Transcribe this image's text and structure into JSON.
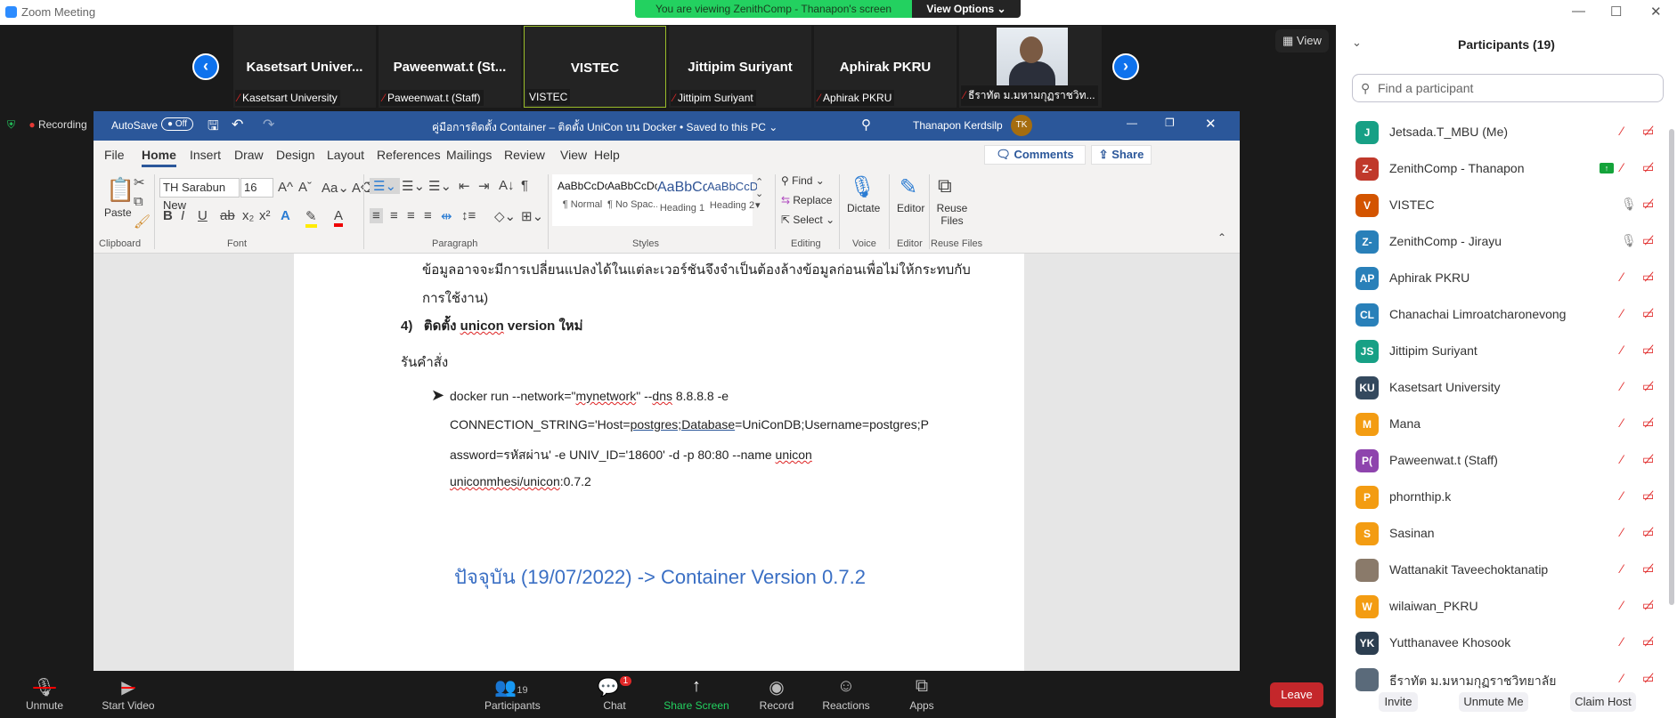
{
  "app_title": "Zoom Meeting",
  "banner": "You are viewing ZenithComp - Thanapon's screen",
  "view_options": "View Options ⌄",
  "view_button": "View",
  "recording": "Recording",
  "thumbnails": [
    {
      "big": "Kasetsart  Univer...",
      "small": "Kasetsart University",
      "muted": true
    },
    {
      "big": "Paweenwat.t  (St...",
      "small": "Paweenwat.t (Staff)",
      "muted": true
    },
    {
      "big": "VISTEC",
      "small": "VISTEC",
      "muted": false,
      "active": true
    },
    {
      "big": "Jittipim Suriyant",
      "small": "Jittipim Suriyant",
      "muted": true
    },
    {
      "big": "Aphirak PKRU",
      "small": "Aphirak PKRU",
      "muted": true
    },
    {
      "big": "",
      "small": "ธีราทัต ม.มหามกุฏราชวิท...",
      "muted": true,
      "photo": true
    }
  ],
  "word": {
    "autosave": "AutoSave",
    "autosave_state": "Off",
    "doc_title": "คู่มือการติดตั้ง Container – ติดตั้ง UniCon บน Docker • Saved to this PC ⌄",
    "user": "Thanapon Kerdsilp",
    "user_initials": "TK",
    "tabs": [
      "File",
      "Home",
      "Insert",
      "Draw",
      "Design",
      "Layout",
      "References",
      "Mailings",
      "Review",
      "View",
      "Help"
    ],
    "comments": "Comments",
    "share": "Share",
    "font": "TH Sarabun New",
    "size": "16",
    "paste": "Paste",
    "groups": [
      "Clipboard",
      "Font",
      "Paragraph",
      "Styles",
      "Editing",
      "Voice",
      "Editor",
      "Reuse Files"
    ],
    "styles": [
      {
        "preview": "AaBbCcDc",
        "name": "¶ Normal"
      },
      {
        "preview": "AaBbCcDc",
        "name": "¶ No Spac..."
      },
      {
        "preview": "AaBbCc",
        "name": "Heading 1"
      },
      {
        "preview": "AaBbCcD",
        "name": "Heading 2"
      }
    ],
    "find": "Find ⌄",
    "replace": "Replace",
    "select": "Select ⌄",
    "dictate": "Dictate",
    "editor": "Editor",
    "reuse_files": "Reuse Files",
    "doc": {
      "line1": "ข้อมูลอาจจะมีการเปลี่ยนแปลงได้ในแต่ละเวอร์ชันจึงจำเป็นต้องล้างข้อมูลก่อนเพื่อไม่ให้กระทบกับ",
      "line2": "การใช้งาน)",
      "step_num": "4)",
      "step_a": "ติดตั้ง ",
      "step_b": "unicon",
      "step_c": " version ใหม่",
      "run": "รันคำสั่ง",
      "cmd1a": "docker run --network=\"",
      "cmd1b": "mynetwork",
      "cmd1c": "\" --",
      "cmd1d": "dns",
      "cmd1e": " 8.8.8.8 -e",
      "cmd2a": "CONNECTION_STRING='Host=",
      "cmd2b": "postgres;Database",
      "cmd2c": "=UniConDB;Username=postgres;P",
      "cmd3a": "assword=รหัสผ่าน' -e UNIV_ID='18600' -d -p 80:80 --name ",
      "cmd3b": "unicon",
      "cmd4a": "uniconmhesi/unicon",
      "cmd4b": ":0.7.2",
      "current": "ปัจจุบัน (19/07/2022) -> Container Version 0.7.2"
    }
  },
  "toolbar": [
    {
      "label": "Unmute",
      "icon": "🎙"
    },
    {
      "label": "Start Video",
      "icon": "▶"
    },
    {
      "label": "Participants",
      "icon": "👥",
      "count": "19"
    },
    {
      "label": "Chat",
      "icon": "💬",
      "badge": "1"
    },
    {
      "label": "Share Screen",
      "icon": "↑"
    },
    {
      "label": "Record",
      "icon": "◉"
    },
    {
      "label": "Reactions",
      "icon": "☺"
    },
    {
      "label": "Apps",
      "icon": "⧉"
    }
  ],
  "leave": "Leave",
  "participants": {
    "title": "Participants (19)",
    "search_placeholder": "Find a participant",
    "list": [
      {
        "initials": "J",
        "name": "Jetsada.T_MBU (Me)",
        "color": "#17a085",
        "mic": "muted"
      },
      {
        "initials": "Z-",
        "name": "ZenithComp - Thanapon",
        "color": "#c0392b",
        "mic": "muted",
        "sharing": true
      },
      {
        "initials": "V",
        "name": "VISTEC",
        "color": "#d35400",
        "mic": "on"
      },
      {
        "initials": "Z-",
        "name": "ZenithComp - Jirayu",
        "color": "#2980b9",
        "mic": "on"
      },
      {
        "initials": "AP",
        "name": "Aphirak PKRU",
        "color": "#2980b9",
        "mic": "muted"
      },
      {
        "initials": "CL",
        "name": "Chanachai Limroatcharonevong",
        "color": "#2980b9",
        "mic": "muted"
      },
      {
        "initials": "JS",
        "name": "Jittipim Suriyant",
        "color": "#17a085",
        "mic": "muted"
      },
      {
        "initials": "KU",
        "name": "Kasetsart University",
        "color": "#34495e",
        "mic": "muted"
      },
      {
        "initials": "M",
        "name": "Mana",
        "color": "#f39c12",
        "mic": "muted"
      },
      {
        "initials": "P(",
        "name": "Paweenwat.t (Staff)",
        "color": "#8e44ad",
        "mic": "muted"
      },
      {
        "initials": "P",
        "name": "phornthip.k",
        "color": "#f39c12",
        "mic": "muted"
      },
      {
        "initials": "S",
        "name": "Sasinan",
        "color": "#f39c12",
        "mic": "muted"
      },
      {
        "initials": "",
        "name": "Wattanakit Taveechoktanatip",
        "color": "#8a7a6a",
        "mic": "muted",
        "photo": true
      },
      {
        "initials": "W",
        "name": "wilaiwan_PKRU",
        "color": "#f39c12",
        "mic": "muted"
      },
      {
        "initials": "YK",
        "name": "Yutthanavee Khosook",
        "color": "#2c3e50",
        "mic": "muted"
      },
      {
        "initials": "",
        "name": "ธีราทัต ม.มหามกุฏราชวิทยาลัย",
        "color": "#5a6a7a",
        "mic": "muted",
        "photo": true
      }
    ],
    "invite": "Invite",
    "unmute_me": "Unmute Me",
    "claim_host": "Claim Host"
  }
}
